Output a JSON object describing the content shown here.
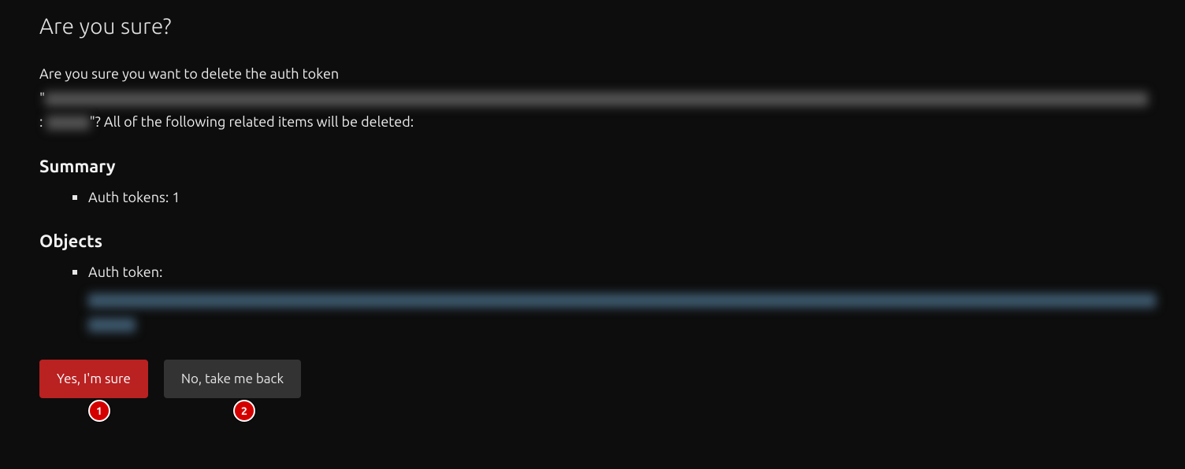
{
  "page": {
    "title": "Are you sure?"
  },
  "confirm": {
    "prefix": "Are you sure you want to delete the auth token ",
    "open_quote": "\"",
    "sep_line2_prefix": " : ",
    "close_quote": "\"? ",
    "suffix": "All of the following related items will be deleted:"
  },
  "summary": {
    "heading": "Summary",
    "items": [
      {
        "label": "Auth tokens",
        "count": 1
      }
    ]
  },
  "objects": {
    "heading": "Objects",
    "items": [
      {
        "label": "Auth token:"
      }
    ]
  },
  "actions": {
    "confirm_label": "Yes, I'm sure",
    "cancel_label": "No, take me back"
  },
  "annotations": {
    "marker1": "1",
    "marker2": "2"
  }
}
